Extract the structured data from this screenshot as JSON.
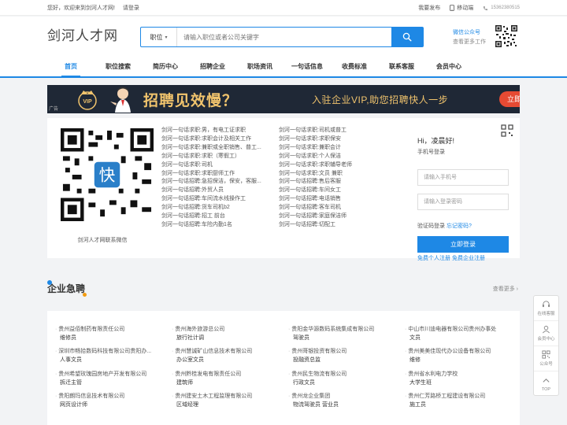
{
  "topbar": {
    "welcome": "您好，欢迎来到剑河人才网!",
    "login": "请登录",
    "my_post": "我要发布",
    "mobile": "移动端",
    "phone": "15362380515"
  },
  "header": {
    "logo": "剑河人才网",
    "search_type": "职位",
    "search_placeholder": "请输入职位或者公司关键字",
    "wx_title": "微信公众号",
    "wx_sub": "查看更多工作"
  },
  "nav": [
    {
      "label": "首页"
    },
    {
      "label": "职位搜索"
    },
    {
      "label": "简历中心"
    },
    {
      "label": "招聘企业"
    },
    {
      "label": "职场资讯"
    },
    {
      "label": "一句话信息"
    },
    {
      "label": "收费标准"
    },
    {
      "label": "联系客服"
    },
    {
      "label": "会员中心"
    }
  ],
  "banner": {
    "ad": "广告",
    "title": "招聘见效慢？",
    "sub": "入驻企业VIP,助您招聘快人一步",
    "cta": "立即查看"
  },
  "qr_caption": "剑河人才网联系微信",
  "oneline_col1": [
    "剑河一句话求职:男，有电工证求职",
    "剑河一句话求职:求职会计及相关工作",
    "剑河一句话求职:兼职或全职销售、普工...",
    "剑河一句话求职:求职（寒假工）",
    "剑河一句话求职:司机",
    "剑河一句话求职:求职厨师工作",
    "剑河一句话招聘:急招保洁，保安，客服...",
    "剑河一句话招聘:外贸人员",
    "剑河一句话招聘:车间流水线操作工",
    "剑河一句话招聘:货车司机b2",
    "剑河一句话招聘:招工 前台",
    "剑河一句话招聘:车险内勤1名"
  ],
  "oneline_col2": [
    "剑河一句话求职:司机或普工",
    "剑河一句话求职:求职保安",
    "剑河一句话求职:兼职会计",
    "剑河一句话求职:个人保洁",
    "剑河一句话求职:求职辅导老师",
    "剑河一句话求职:文员 兼职",
    "剑河一句话招聘:售后客服",
    "剑河一句话招聘:车间女工",
    "剑河一句话招聘:电话销售",
    "剑河一句话招聘:客车司机",
    "剑河一句话招聘:家庭保洁师",
    "剑河一句话招聘:切配工"
  ],
  "login": {
    "greeting": "Hi，凌晨好!",
    "phone_label": "手机号登录",
    "phone_placeholder": "请输入手机号",
    "pwd_placeholder": "请输入登录密码",
    "code_login": "验证码登录",
    "forgot": "忘记密码?",
    "button": "立即登录",
    "register": "免费个人注册  免费企业注册"
  },
  "section": {
    "title": "企业急聘",
    "more": "查看更多 ›"
  },
  "jobs": [
    {
      "company": "贵州益佰制药有限责任公司",
      "position": "维修员"
    },
    {
      "company": "贵州海外旅游总公司",
      "position": "旅行社计调"
    },
    {
      "company": "贵阳金华源数码系统集成有限公司",
      "position": "驾驶员"
    },
    {
      "company": "中山市川迪电器有限公司贵州办事处",
      "position": "文员"
    },
    {
      "company": "深圳市畅拾数码科技有限公司贵阳办...",
      "position": "人事文员"
    },
    {
      "company": "贵州慧诚矿山信息技术有限公司",
      "position": "办公室文员"
    },
    {
      "company": "贵州哥银投资有限公司",
      "position": "投融资总监"
    },
    {
      "company": "贵州美美佳现代办公设备有限公司",
      "position": "维修"
    },
    {
      "company": "贵州希望玫瑰园房地产开发有限公司",
      "position": "拆迁主管"
    },
    {
      "company": "贵州黔桂发电有限责任公司",
      "position": "建筑师"
    },
    {
      "company": "贵州民生物流有限公司",
      "position": "行政文员"
    },
    {
      "company": "贵州省水利电力学校",
      "position": "大学生班"
    },
    {
      "company": "贵阳朗玛信息技术有限公司",
      "position": "网页设计师"
    },
    {
      "company": "贵州建安土木工程监理有限公司",
      "position": "区域经理"
    },
    {
      "company": "贵州龙企业集团",
      "position": "物流驾驶员 营业员"
    },
    {
      "company": "贵州仁芳路桥工程建设有限公司",
      "position": "施工员"
    }
  ],
  "sidebar": [
    {
      "label": "在线客服"
    },
    {
      "label": "会员中心"
    },
    {
      "label": "公众号"
    },
    {
      "label": "TOP"
    }
  ]
}
